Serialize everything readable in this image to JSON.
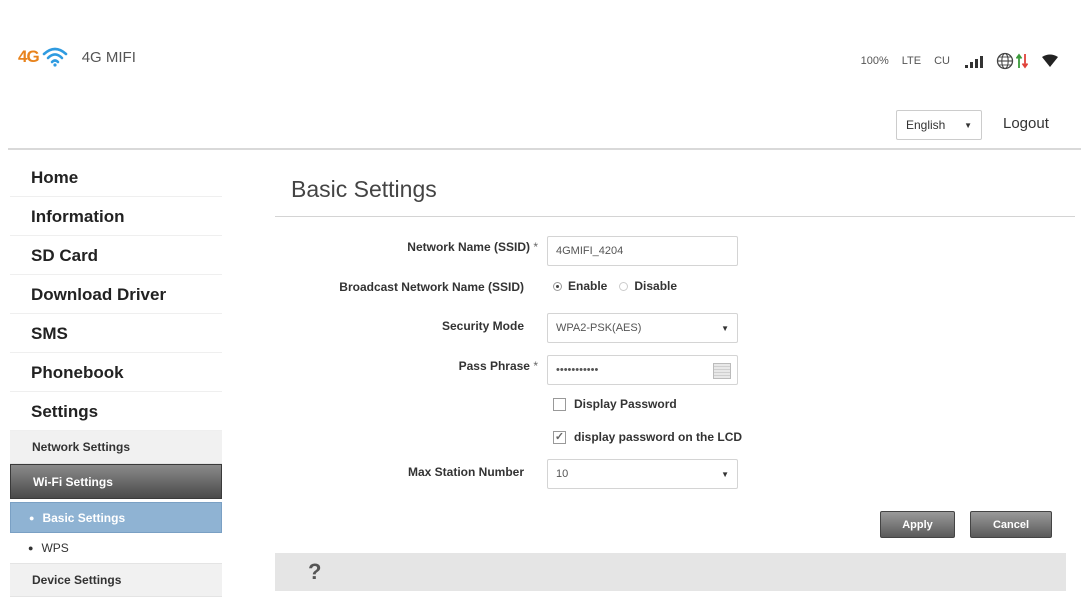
{
  "header": {
    "logo_4g": "4G",
    "brand": "4G MIFI",
    "status": {
      "battery": "100%",
      "network_type": "LTE",
      "carrier": "CU"
    },
    "language": "English",
    "logout": "Logout"
  },
  "sidebar": {
    "items": [
      {
        "label": "Home"
      },
      {
        "label": "Information"
      },
      {
        "label": "SD Card"
      },
      {
        "label": "Download Driver"
      },
      {
        "label": "SMS"
      },
      {
        "label": "Phonebook"
      },
      {
        "label": "Settings"
      }
    ],
    "settings_sub": {
      "network_settings": "Network Settings",
      "wifi_settings": "Wi-Fi Settings",
      "basic_settings": "Basic Settings",
      "wps": "WPS",
      "device_settings": "Device Settings"
    }
  },
  "main": {
    "title": "Basic Settings",
    "form": {
      "ssid_label": "Network Name (SSID)",
      "required_mark": "*",
      "ssid_value": "4GMIFI_4204",
      "broadcast_label": "Broadcast Network Name (SSID)",
      "enable_label": "Enable",
      "disable_label": "Disable",
      "broadcast_selected": "Enable",
      "security_label": "Security Mode",
      "security_value": "WPA2-PSK(AES)",
      "pass_label": "Pass Phrase",
      "pass_value": "•••••••••••",
      "display_password_label": "Display Password",
      "display_password_checked": false,
      "display_lcd_label": "display password on the LCD",
      "display_lcd_checked": true,
      "max_station_label": "Max Station Number",
      "max_station_value": "10"
    },
    "buttons": {
      "apply": "Apply",
      "cancel": "Cancel"
    },
    "help": "?"
  },
  "colors": {
    "accent_orange": "#e8831d",
    "wifi_blue": "#2f9be0",
    "active_blue": "#8fb3d3",
    "button_gray": "#5a5a5a"
  },
  "icons": [
    "wifi-icon",
    "signal-bars-icon",
    "globe-icon",
    "data-arrows-icon",
    "wifi-strength-icon",
    "help-icon",
    "eye-icon"
  ]
}
